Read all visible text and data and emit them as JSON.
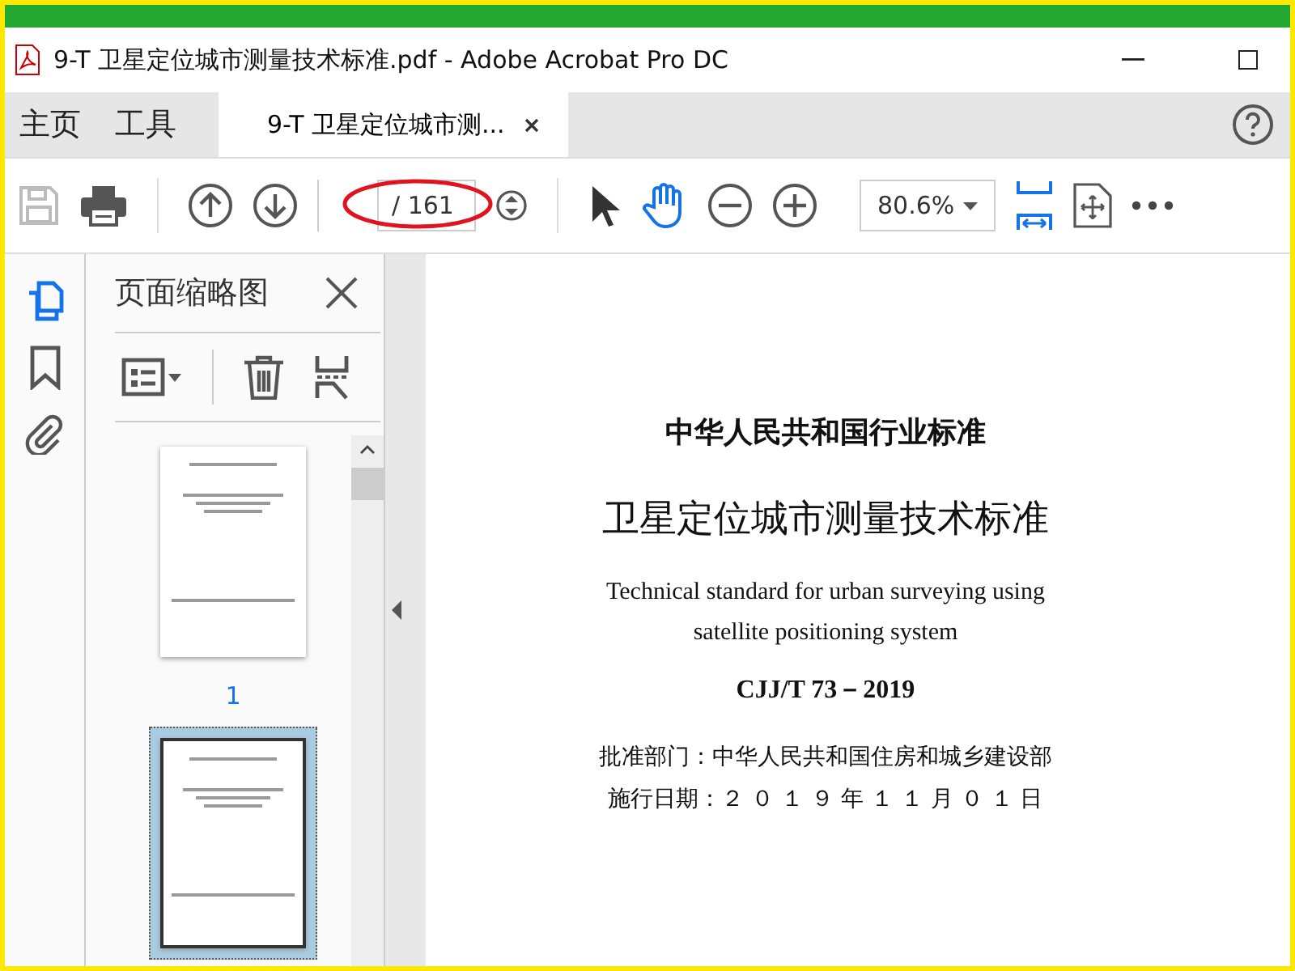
{
  "window": {
    "title": "9-T 卫星定位城市测量技术标准.pdf - Adobe Acrobat Pro DC"
  },
  "tabs": [
    {
      "label": "主页",
      "selected": false,
      "kind": "nav"
    },
    {
      "label": "工具",
      "selected": false,
      "kind": "nav"
    },
    {
      "label": "9-T 卫星定位城市测...",
      "selected": true,
      "kind": "doc"
    }
  ],
  "toolbar": {
    "page_total": "/ 161",
    "zoom": "80.6%"
  },
  "rail": [
    {
      "kind": "pages",
      "selected": true
    },
    {
      "kind": "bookmark",
      "selected": false
    },
    {
      "kind": "attach",
      "selected": false
    }
  ],
  "panel": {
    "title": "页面缩略图"
  },
  "thumbnails": [
    {
      "label": "1",
      "selected": false
    },
    {
      "selected": true
    }
  ],
  "document": {
    "lines": [
      {
        "kind": "heading",
        "text": "中华人民共和国行业标准"
      },
      {
        "kind": "title",
        "text": "卫星定位城市测量技术标准"
      },
      {
        "kind": "english",
        "text": "Technical standard for urban surveying using"
      },
      {
        "kind": "english",
        "text": "satellite positioning system"
      },
      {
        "kind": "code",
        "text": "CJJ/T 73－2019"
      },
      {
        "kind": "meta",
        "text": "批准部门：中华人民共和国住房和城乡建设部"
      },
      {
        "kind": "meta",
        "text": "施行日期：２ ０ １ ９ 年 １ １ 月 ０ １ 日"
      }
    ]
  }
}
